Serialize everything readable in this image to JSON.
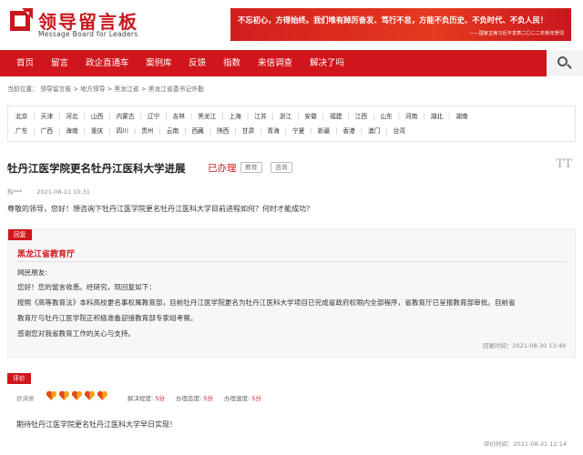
{
  "header": {
    "logo_title": "领导留言板",
    "logo_subtitle": "Message Board for Leaders",
    "banner_slogan": "不忘初心，方得始终。我们唯有踔厉奋发、笃行不怠，方能不负历史、不负时代、不负人民！",
    "banner_source": "——国家主席习近平发表二〇二二年新年贺词"
  },
  "nav": {
    "items": [
      "首页",
      "留言",
      "政企直通车",
      "案例库",
      "反馈",
      "指数",
      "来信调查",
      "解决了吗"
    ],
    "search_icon": "search-icon"
  },
  "breadcrumb": {
    "prefix": "当前位置：",
    "items": [
      "领导留言板",
      "地方领导",
      "黑龙江省",
      "黑龙江省委书记许勤"
    ],
    "separator": ">"
  },
  "regions": {
    "row1": [
      "北京",
      "天津",
      "河北",
      "山西",
      "内蒙古",
      "辽宁",
      "吉林",
      "黑龙江",
      "上海",
      "江苏",
      "浙江",
      "安徽",
      "福建",
      "江西",
      "山东",
      "河南",
      "湖北",
      "湖南"
    ],
    "row2": [
      "广东",
      "广西",
      "海南",
      "重庆",
      "四川",
      "贵州",
      "云南",
      "西藏",
      "陕西",
      "甘肃",
      "青海",
      "宁夏",
      "新疆",
      "香港",
      "澳门",
      "台湾"
    ]
  },
  "message": {
    "title": "牡丹江医学院更名牡丹江医科大学进展",
    "status": "已办理",
    "tags": [
      "教育",
      "咨询"
    ],
    "author": "热***",
    "date": "2021-08-11 10:31",
    "body": "尊敬的领导，您好！想咨询下牡丹江医学院更名牡丹江医科大学目前进程如何？何时才能成功？",
    "font_icon": "TT"
  },
  "reply": {
    "label": "回复",
    "org": "黑龙江省教育厅",
    "lines": [
      "网民朋友:",
      "您好！您的留言收悉。经研究，现回复如下：",
      "按照《高等教育法》本科高校更名事权属教育部，目前牡丹江医学院更名为牡丹江医科大学项目已完成省政府权限内全部程序，省教育厅已呈报教育部审批。目前省",
      "教育厅与牡丹江医学院正积极准备迎接教育部专家组考察。",
      "感谢您对我省教育工作的关心与支持。"
    ],
    "date_label": "回复时间：",
    "date": "2021-08-30 13:49"
  },
  "rating": {
    "label": "评价",
    "satisfaction_label": "很满意",
    "hearts": 5,
    "scores": [
      {
        "label": "解决程度:",
        "value": "5分"
      },
      {
        "label": "办理态度:",
        "value": "5分"
      },
      {
        "label": "办理速度:",
        "value": "5分"
      }
    ],
    "comment": "期待牡丹江医学院更名牡丹江医科大学早日实现！",
    "date_label": "评价时间：",
    "date": "2021-08-31 12:14"
  },
  "colors": {
    "accent": "#d0161c",
    "banner": "#e53a1f",
    "heart": "#f5a21b"
  }
}
